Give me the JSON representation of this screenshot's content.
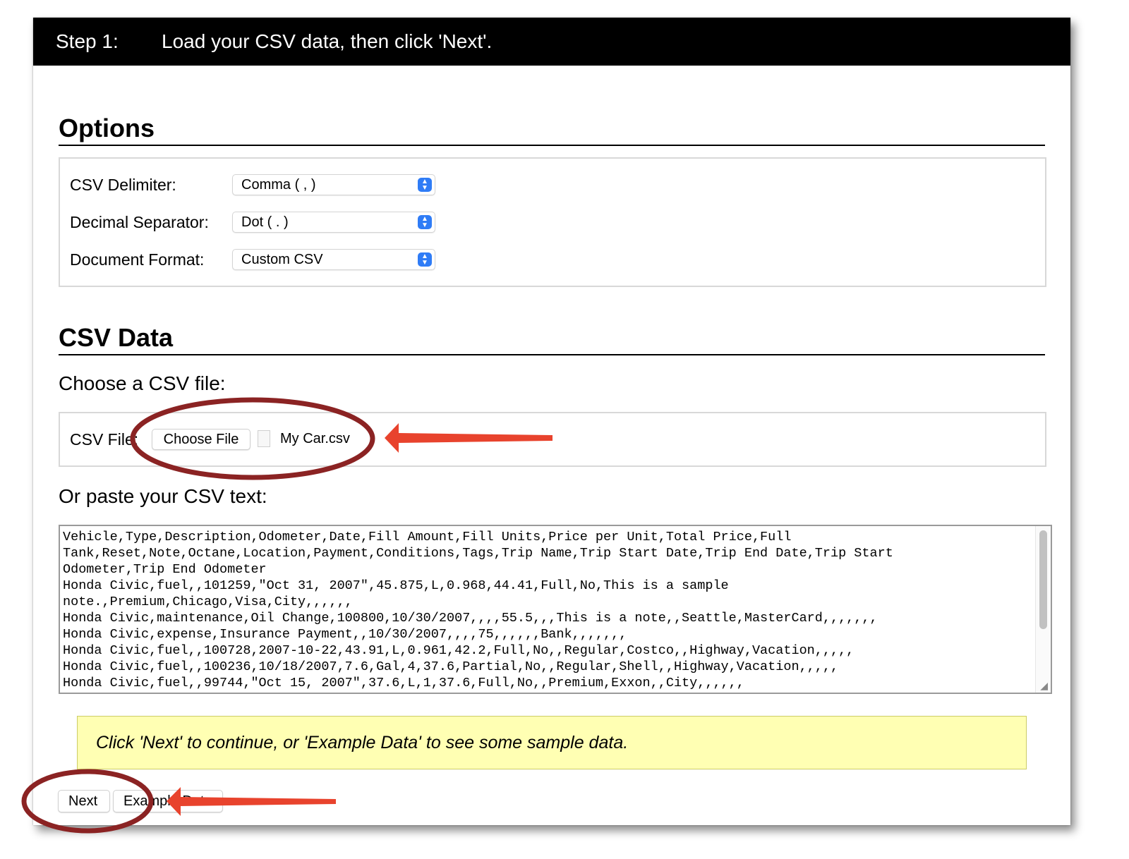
{
  "header": {
    "step": "Step 1:",
    "instruction": "Load your CSV data, then click 'Next'."
  },
  "options": {
    "title": "Options",
    "rows": [
      {
        "label": "CSV Delimiter:",
        "value": "Comma ( , )"
      },
      {
        "label": "Decimal Separator:",
        "value": "Dot ( . )"
      },
      {
        "label": "Document Format:",
        "value": "Custom CSV"
      }
    ]
  },
  "csv_data": {
    "title": "CSV Data",
    "choose_label": "Choose a CSV file:",
    "file_label": "CSV File:",
    "choose_button": "Choose File",
    "file_name": "My Car.csv",
    "paste_label": "Or paste your CSV text:",
    "text": "Vehicle,Type,Description,Odometer,Date,Fill Amount,Fill Units,Price per Unit,Total Price,Full\nTank,Reset,Note,Octane,Location,Payment,Conditions,Tags,Trip Name,Trip Start Date,Trip End Date,Trip Start\nOdometer,Trip End Odometer\nHonda Civic,fuel,,101259,\"Oct 31, 2007\",45.875,L,0.968,44.41,Full,No,This is a sample\nnote.,Premium,Chicago,Visa,City,,,,,,\nHonda Civic,maintenance,Oil Change,100800,10/30/2007,,,,55.5,,,This is a note,,Seattle,MasterCard,,,,,,,\nHonda Civic,expense,Insurance Payment,,10/30/2007,,,,75,,,,,,Bank,,,,,,,\nHonda Civic,fuel,,100728,2007-10-22,43.91,L,0.961,42.2,Full,No,,Regular,Costco,,Highway,Vacation,,,,,\nHonda Civic,fuel,,100236,10/18/2007,7.6,Gal,4,37.6,Partial,No,,Regular,Shell,,Highway,Vacation,,,,,\nHonda Civic,fuel,,99744,\"Oct 15, 2007\",37.6,L,1,37.6,Full,No,,Premium,Exxon,,City,,,,,,"
  },
  "notice": "Click 'Next' to continue, or 'Example Data' to see some sample data.",
  "buttons": {
    "next": "Next",
    "example": "Example Data"
  },
  "colors": {
    "header_bg": "#000000",
    "notice_bg": "#ffffb3",
    "annotation_ring": "#8b2323",
    "annotation_arrow": "#e8432d",
    "select_accent": "#2f7cf6"
  }
}
